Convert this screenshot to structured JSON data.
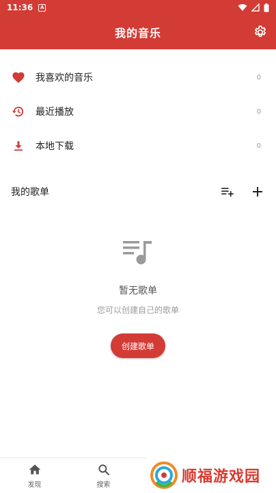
{
  "status_bar": {
    "time": "11:36",
    "notification_badge": "A"
  },
  "app_bar": {
    "title": "我的音乐",
    "settings_icon": "gear-icon"
  },
  "menu_items": [
    {
      "label": "我喜欢的音乐",
      "count": "0",
      "icon": "heart-icon"
    },
    {
      "label": "最近播放",
      "count": "0",
      "icon": "history-icon"
    },
    {
      "label": "本地下载",
      "count": "0",
      "icon": "download-icon"
    }
  ],
  "playlists": {
    "label": "我的歌单",
    "empty_title": "暂无歌单",
    "empty_subtitle": "您可以创建自己的歌单",
    "create_button": "创建歌单"
  },
  "bottom_nav": {
    "tabs": [
      {
        "label": "发现",
        "icon": "home-icon"
      },
      {
        "label": "搜索",
        "icon": "search-icon"
      }
    ]
  },
  "watermark": {
    "text": "顺福游戏园"
  },
  "colors": {
    "accent": "#d33b35",
    "muted_text": "#9b9b9b"
  }
}
